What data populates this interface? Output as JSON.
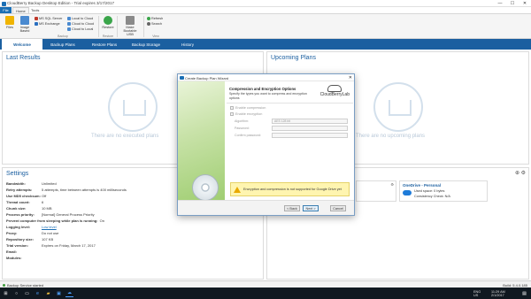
{
  "window": {
    "title": "CloudBerry Backup Desktop Edition - Trial expires 3/17/2017",
    "controls": [
      "—",
      "☐",
      "✕"
    ]
  },
  "ribbon_tabs": {
    "file": "File",
    "home": "Home",
    "tools": "Tools"
  },
  "ribbon": {
    "files_label": "Files",
    "image_based_label": "Image Based",
    "ms_sql_label": "MS SQL Server",
    "ms_exchange_label": "MS Exchange",
    "local_to_cloud_label": "Local to Cloud",
    "cloud_to_cloud_label": "Cloud to Cloud",
    "cloud_to_local_label": "Cloud to Local",
    "restore_label": "Restore",
    "make_bootable_label": "Make Bootable USB",
    "refresh_label": "Refresh",
    "search_label": "Search",
    "group_backup": "Backup",
    "group_restore": "Restore",
    "group_view": "View"
  },
  "nav": {
    "tabs": [
      "Welcome",
      "Backup Plans",
      "Restore Plans",
      "Backup Storage",
      "History"
    ],
    "active": "Welcome"
  },
  "last_results": {
    "title": "Last Results",
    "empty": "There are no executed plans"
  },
  "upcoming": {
    "title": "Upcoming Plans",
    "empty": "There are no upcoming plans"
  },
  "settings": {
    "title": "Settings",
    "rows": [
      {
        "key": "Bandwidth:",
        "value": "Unlimited"
      },
      {
        "key": "Retry attempts:",
        "value": "5 attempts, time between attempts is 400 milliseconds"
      },
      {
        "key": "Use MD5 checksum:",
        "value": "Off"
      },
      {
        "key": "Thread count:",
        "value": "6"
      },
      {
        "key": "Chunk size:",
        "value": "10 MB"
      },
      {
        "key": "Process priority:",
        "value": "[Normal] General Process Priority"
      },
      {
        "key": "Prevent computer from sleeping while plan is running:",
        "value": "On"
      },
      {
        "key": "Logging level:",
        "value": "Low level"
      },
      {
        "key": "Proxy:",
        "value": "Do not use"
      },
      {
        "key": "Repository size:",
        "value": "107 KB"
      },
      {
        "key": "Trial version:",
        "value": "Expires on Friday, March 17, 2017"
      },
      {
        "key": "Email:",
        "value": ""
      },
      {
        "key": "Modules:",
        "value": ""
      }
    ]
  },
  "storage_panel": {
    "name": "OneDrive - Personal",
    "used": "Used space: 0 bytes",
    "consistency": "Consistency Check: N/A"
  },
  "status": {
    "left": "Backup Service started",
    "build": "Build: 5.4.0.185"
  },
  "taskbar": {
    "lang": "ENG",
    "region": "US",
    "time": "11:29 AM",
    "date": "2/1/2017"
  },
  "dialog": {
    "title": "Create Backup Plan Wizard",
    "heading": "Compression and Encryption Options",
    "subheading": "Specify the types you want to compress and encryption options",
    "logo": "CloudBerryLab",
    "enable_compression": "Enable compression",
    "enable_encryption": "Enable encryption",
    "algorithm_label": "Algorithm:",
    "algorithm_value": "AES 128 bit",
    "password_label": "Password:",
    "confirm_label": "Confirm password:",
    "warning": "Encryption and compression is not supported for Google Drive yet",
    "back": "< Back",
    "next": "Next >",
    "cancel": "Cancel"
  }
}
